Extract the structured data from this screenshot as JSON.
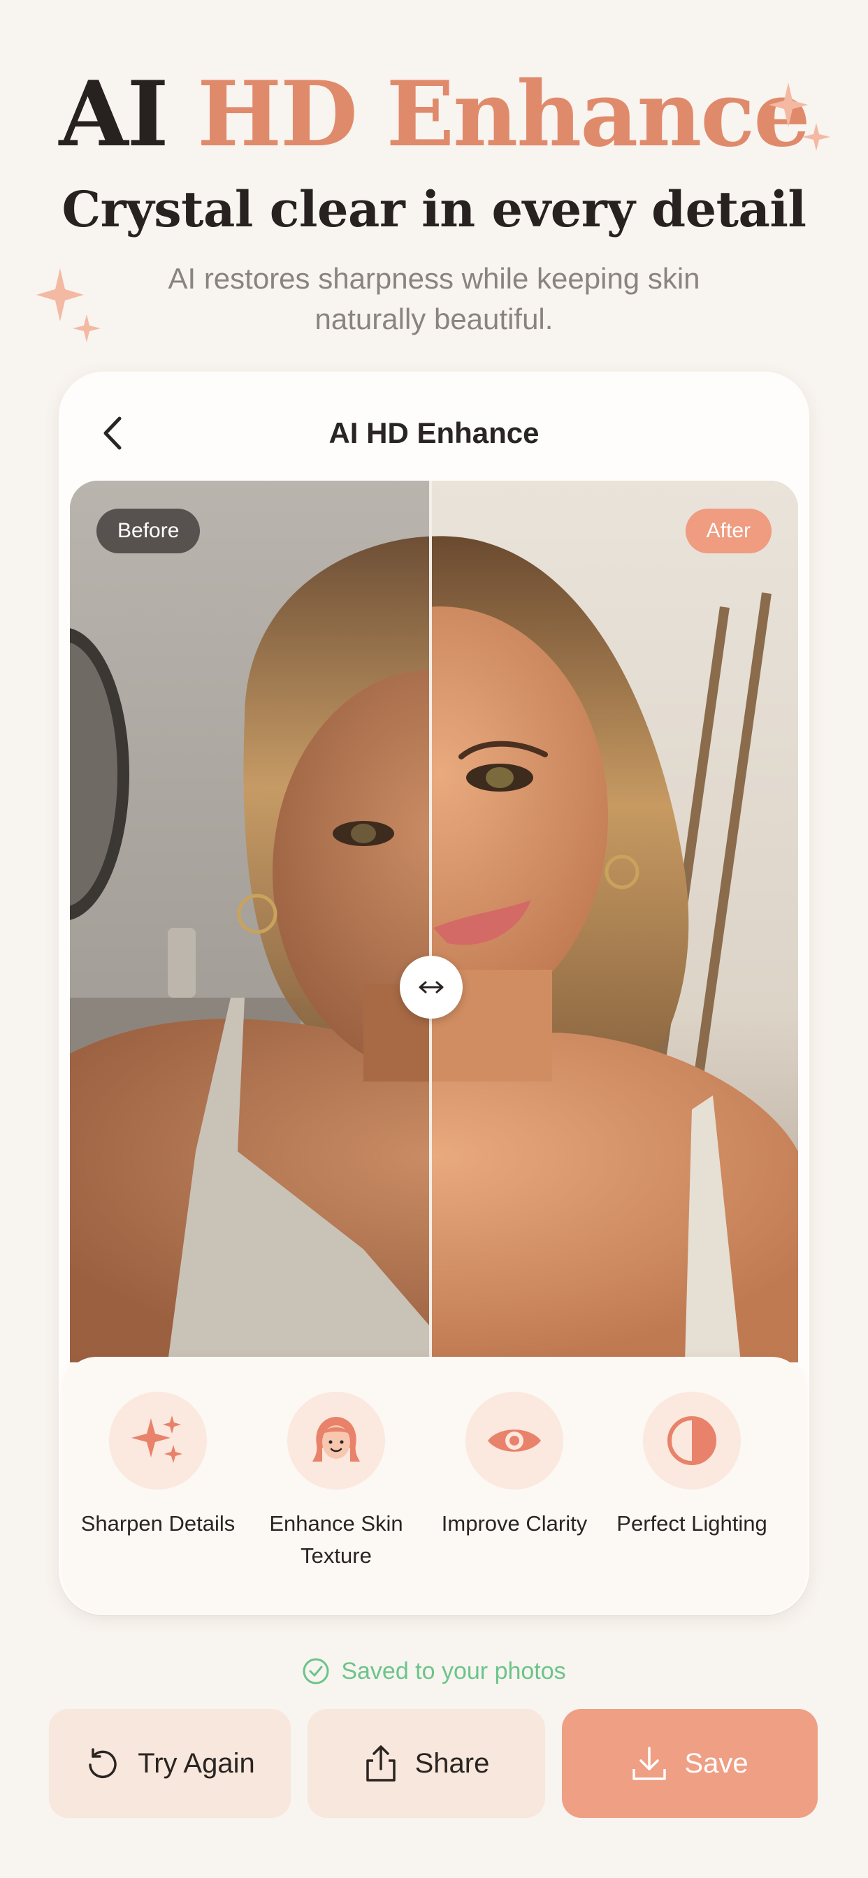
{
  "hero": {
    "title_dark": "AI",
    "title_accent": "HD Enhance",
    "subtitle": "Crystal clear in every detail",
    "description": "AI restores sharpness while keeping skin naturally beautiful."
  },
  "editor": {
    "title": "AI HD Enhance",
    "before_label": "Before",
    "after_label": "After",
    "slider_position": 0.5
  },
  "features": [
    {
      "label": "Sharpen Details",
      "icon": "sparkles-icon"
    },
    {
      "label": "Enhance Skin Texture",
      "icon": "face-icon"
    },
    {
      "label": "Improve Clarity",
      "icon": "eye-icon"
    },
    {
      "label": "Perfect Lighting",
      "icon": "half-circle-icon"
    }
  ],
  "status": {
    "saved_text": "Saved to your photos"
  },
  "actions": {
    "try_again": "Try Again",
    "share": "Share",
    "save": "Save"
  },
  "colors": {
    "accent": "#e08a6c",
    "background": "#f8f4ef",
    "success": "#6cc48a",
    "save_button": "#ef9f84"
  }
}
